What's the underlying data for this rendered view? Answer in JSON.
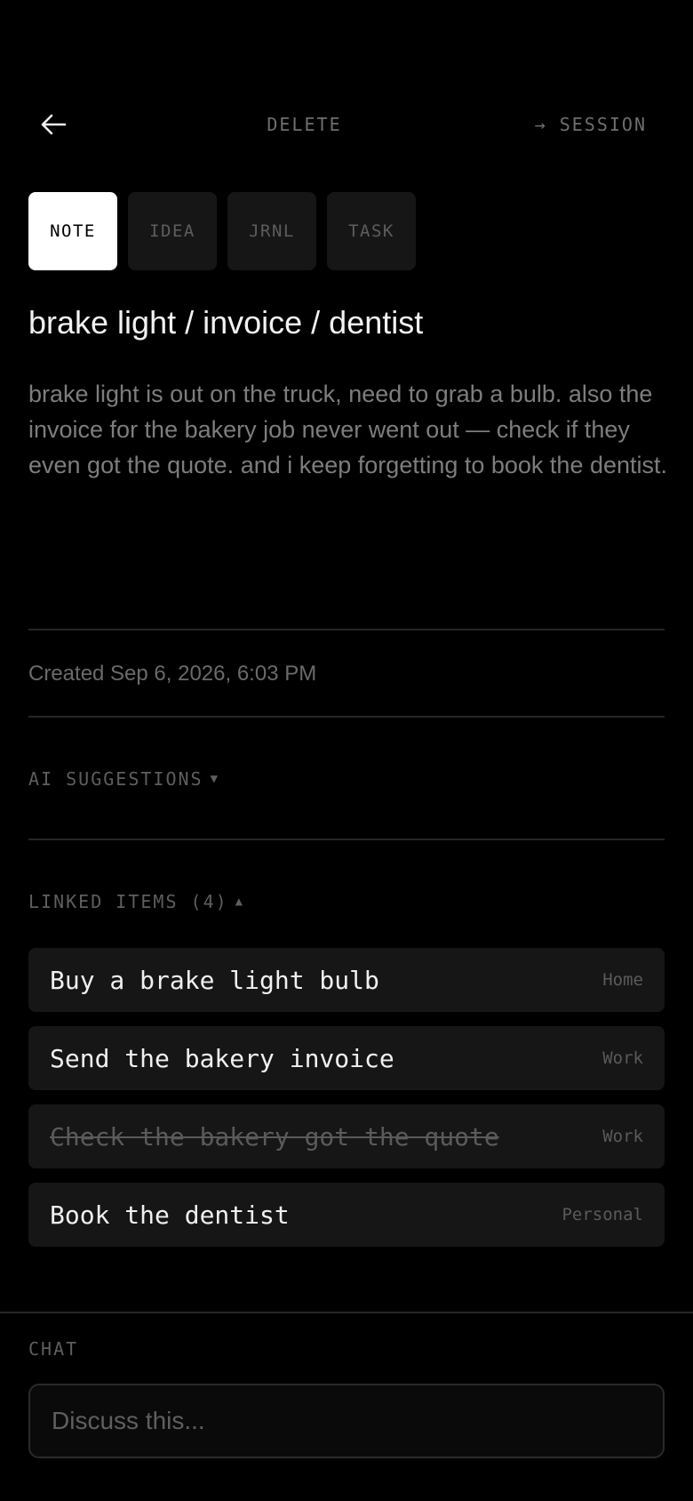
{
  "header": {
    "back_icon": "arrow-left-icon",
    "delete_label": "DELETE",
    "session_label": "→ SESSION"
  },
  "type_tabs": [
    {
      "label": "NOTE",
      "active": true
    },
    {
      "label": "IDEA",
      "active": false
    },
    {
      "label": "JRNL",
      "active": false
    },
    {
      "label": "TASK",
      "active": false
    }
  ],
  "note": {
    "title": "brake light / invoice / dentist",
    "body": "brake light is out on the truck, need to grab a bulb. also the invoice for the bakery job never went out — check if they even got the quote. and i keep forgetting to book the dentist.",
    "created": "Created Sep 6, 2026, 6:03 PM"
  },
  "ai_suggestions": {
    "label": "AI SUGGESTIONS",
    "caret": "▼"
  },
  "linked_items": {
    "label": "LINKED ITEMS (4)",
    "caret": "▲",
    "items": [
      {
        "label": "Buy a brake light bulb",
        "tag": "Home",
        "done": false
      },
      {
        "label": "Send the bakery invoice",
        "tag": "Work",
        "done": false
      },
      {
        "label": "Check the bakery got the quote",
        "tag": "Work",
        "done": true
      },
      {
        "label": "Book the dentist",
        "tag": "Personal",
        "done": false
      }
    ]
  },
  "chat": {
    "label": "CHAT",
    "placeholder": "Discuss this..."
  },
  "colors": {
    "background": "#000000",
    "card": "#161616",
    "active_tab": "#ffffff",
    "muted_text": "#6e6e6e"
  }
}
